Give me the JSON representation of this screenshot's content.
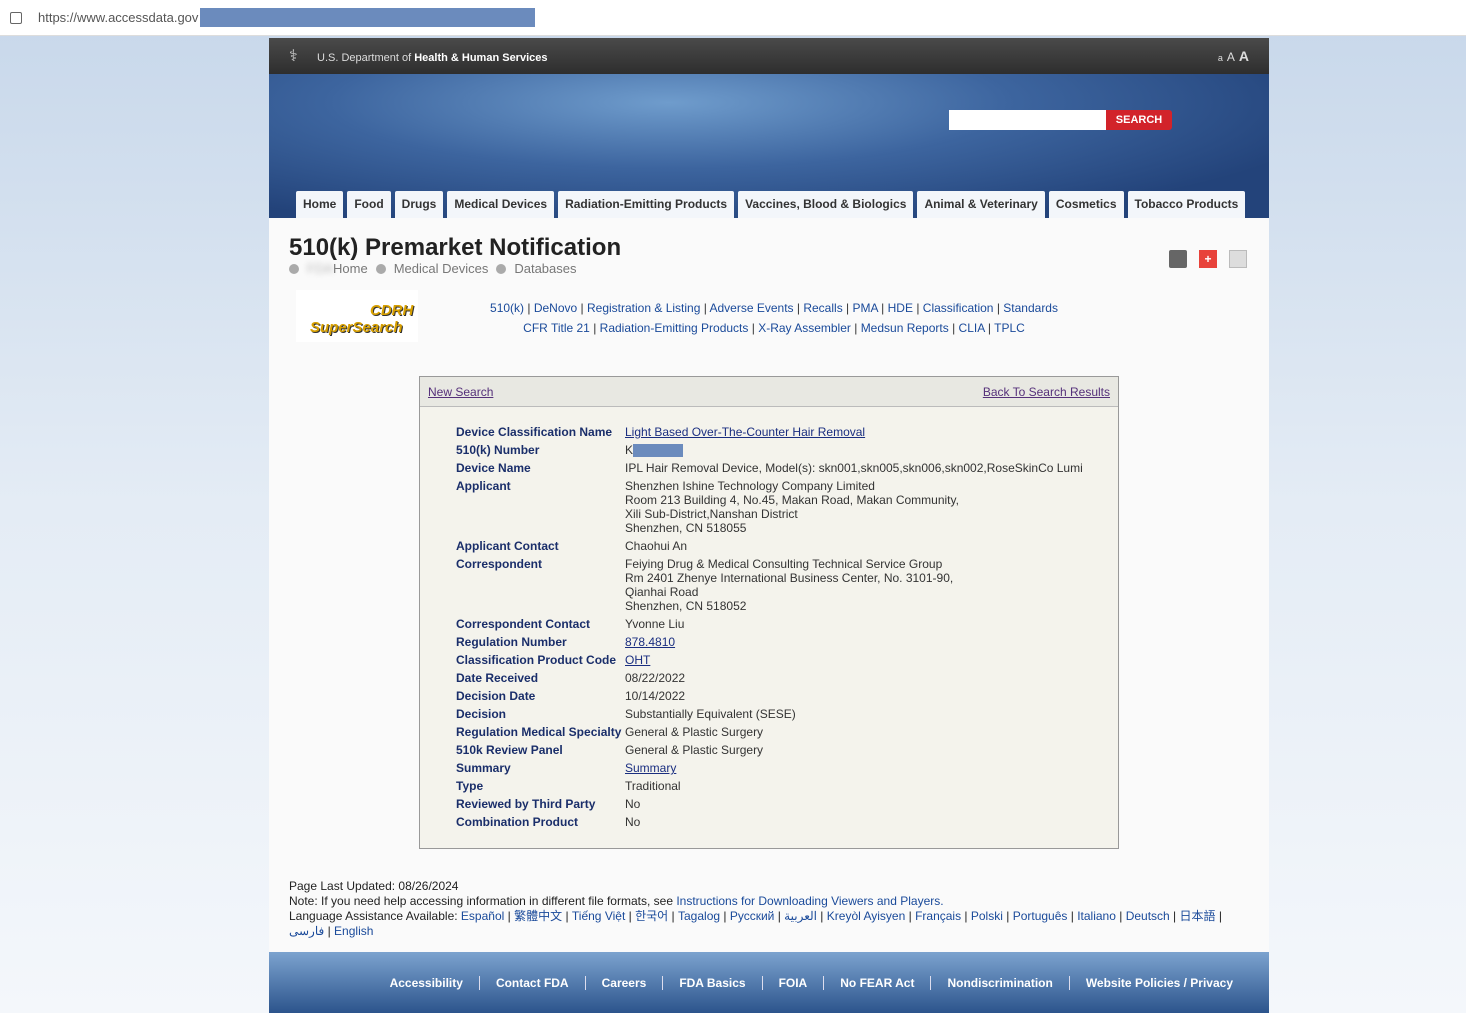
{
  "browser": {
    "url": "https://www.accessdata.",
    "url_suffix": "gov"
  },
  "topbar": {
    "dept_prefix": "U.S. Department of",
    "dept_name": "Health & Human Services",
    "sizes": [
      "a",
      "A",
      "A"
    ]
  },
  "search": {
    "button": "SEARCH",
    "value": ""
  },
  "nav": [
    "Home",
    "Food",
    "Drugs",
    "Medical Devices",
    "Radiation-Emitting Products",
    "Vaccines, Blood & Biologics",
    "Animal & Veterinary",
    "Cosmetics",
    "Tobacco Products"
  ],
  "page": {
    "title": "510(k) Premarket Notification",
    "breadcrumb": [
      "FDA",
      "Home",
      "Medical Devices",
      "Databases"
    ]
  },
  "logo": {
    "line1": "CDRH",
    "line2": "SuperSearch"
  },
  "links": {
    "row1": [
      "510(k)",
      "DeNovo",
      "Registration & Listing",
      "Adverse Events",
      "Recalls",
      "PMA",
      "HDE",
      "Classification",
      "Standards"
    ],
    "row2": [
      "CFR Title 21",
      "Radiation-Emitting Products",
      "X-Ray Assembler",
      "Medsun Reports",
      "CLIA",
      "TPLC"
    ]
  },
  "box": {
    "new_search": "New Search",
    "back": "Back To Search Results",
    "rows": [
      {
        "label": "Device Classification Name",
        "value": [
          "Light Based Over-The-Counter Hair Removal"
        ],
        "link": true
      },
      {
        "label": "510(k) Number",
        "value": [
          "K"
        ],
        "redacted": true
      },
      {
        "label": "Device Name",
        "value": [
          "IPL Hair Removal Device, Model(s): skn001,skn005,skn006,skn002,RoseSkinCo Lumi"
        ]
      },
      {
        "label": "Applicant",
        "value": [
          "Shenzhen Ishine Technology Company Limited",
          "Room 213 Building 4, No.45, Makan Road, Makan Community,",
          "Xili Sub-District,Nanshan District",
          "Shenzhen,  CN 518055"
        ]
      },
      {
        "label": "Applicant Contact",
        "value": [
          "Chaohui An"
        ]
      },
      {
        "label": "Correspondent",
        "value": [
          "Feiying Drug & Medical Consulting Technical Service Group",
          "Rm 2401 Zhenye International Business Center, No. 3101-90,",
          "Qianhai Road",
          "Shenzhen,  CN 518052"
        ]
      },
      {
        "label": "Correspondent Contact",
        "value": [
          "Yvonne Liu"
        ]
      },
      {
        "label": "Regulation Number",
        "value": [
          "878.4810"
        ],
        "link": true
      },
      {
        "label": "Classification Product Code",
        "value": [
          "OHT"
        ],
        "link": true
      },
      {
        "label": "Date Received",
        "value": [
          "08/22/2022"
        ]
      },
      {
        "label": "Decision Date",
        "value": [
          "10/14/2022"
        ]
      },
      {
        "label": "Decision",
        "value": [
          "Substantially Equivalent (SESE)"
        ]
      },
      {
        "label": "Regulation Medical Specialty",
        "value": [
          "General & Plastic Surgery"
        ]
      },
      {
        "label": "510k Review Panel",
        "value": [
          "General & Plastic Surgery"
        ]
      },
      {
        "label": "Summary",
        "value": [
          "Summary"
        ],
        "link": true
      },
      {
        "label": "Type",
        "value": [
          "Traditional"
        ]
      },
      {
        "label": "Reviewed by Third Party",
        "value": [
          "No"
        ]
      },
      {
        "label": "Combination Product",
        "value": [
          "No"
        ]
      }
    ]
  },
  "footinfo": {
    "updated": "Page Last Updated: 08/26/2024",
    "note": "Note: If you need help accessing information in different file formats, see",
    "note_link": "Instructions for Downloading Viewers and Players.",
    "lang_label": "Language Assistance Available:",
    "languages": [
      "Español",
      "繁體中文",
      "Tiếng Việt",
      "한국어",
      "Tagalog",
      "Русский",
      "العربية",
      "Kreyòl Ayisyen",
      "Français",
      "Polski",
      "Português",
      "Italiano",
      "Deutsch",
      "日本語",
      "فارسی",
      "English"
    ]
  },
  "footer": [
    "Accessibility",
    "Contact FDA",
    "Careers",
    "FDA Basics",
    "FOIA",
    "No FEAR Act",
    "Nondiscrimination",
    "Website Policies / Privacy"
  ]
}
